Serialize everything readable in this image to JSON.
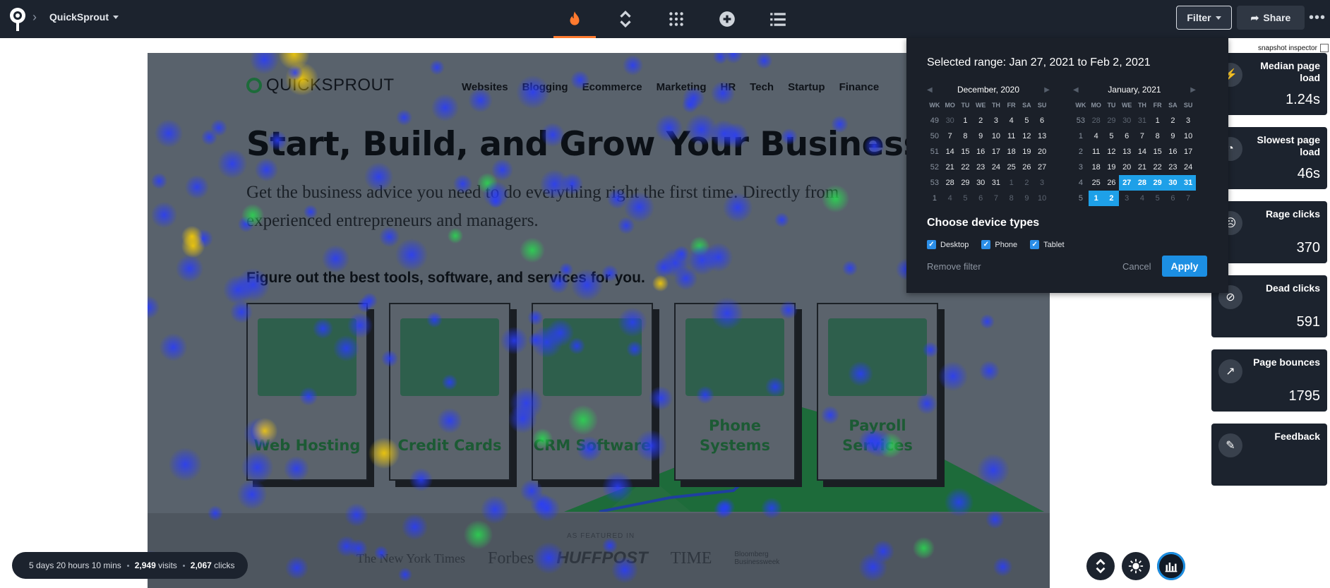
{
  "header": {
    "project_name": "QuickSprout",
    "filter_label": "Filter",
    "share_label": "Share",
    "more_label": "•••",
    "tools": [
      "heatmap",
      "scroll",
      "grid",
      "add",
      "list"
    ]
  },
  "snapshot_inspector": "snapshot inspector",
  "site": {
    "logo_text": "QUICKSPROUT",
    "nav": [
      "Websites",
      "Blogging",
      "Ecommerce",
      "Marketing",
      "HR",
      "Tech",
      "Startup",
      "Finance"
    ],
    "hero_title": "Start, Build, and Grow Your Business",
    "hero_sub": "Get the business advice you need to do everything right the first time. Directly from experienced entrepreneurs and managers.",
    "section_title": "Figure out the best tools, software, and services for you.",
    "cards": [
      {
        "label": "Web Hosting"
      },
      {
        "label": "Credit Cards"
      },
      {
        "label": "CRM Software"
      },
      {
        "label": "Phone Systems"
      },
      {
        "label": "Payroll Services"
      }
    ],
    "featured_caption": "AS FEATURED IN",
    "press": [
      "The New York Times",
      "Forbes",
      "HUFFPOST",
      "TIME",
      "Bloomberg Businessweek"
    ]
  },
  "filter_panel": {
    "range_text": "Selected range: Jan 27, 2021 to Feb 2, 2021",
    "device_heading": "Choose device types",
    "devices": [
      "Desktop",
      "Phone",
      "Tablet"
    ],
    "remove_label": "Remove filter",
    "cancel_label": "Cancel",
    "apply_label": "Apply",
    "calendars": [
      {
        "title": "December, 2020",
        "dow": [
          "WK",
          "MO",
          "TU",
          "WE",
          "TH",
          "FR",
          "SA",
          "SU"
        ],
        "rows": [
          [
            "49",
            "30",
            "1",
            "2",
            "3",
            "4",
            "5",
            "6"
          ],
          [
            "50",
            "7",
            "8",
            "9",
            "10",
            "11",
            "12",
            "13"
          ],
          [
            "51",
            "14",
            "15",
            "16",
            "17",
            "18",
            "19",
            "20"
          ],
          [
            "52",
            "21",
            "22",
            "23",
            "24",
            "25",
            "26",
            "27"
          ],
          [
            "53",
            "28",
            "29",
            "30",
            "31",
            "1",
            "2",
            "3"
          ],
          [
            "1",
            "4",
            "5",
            "6",
            "7",
            "8",
            "9",
            "10"
          ]
        ],
        "out": [
          [
            0,
            1
          ],
          [
            4,
            5
          ],
          [
            4,
            6
          ],
          [
            4,
            7
          ],
          [
            5,
            1
          ],
          [
            5,
            2
          ],
          [
            5,
            3
          ],
          [
            5,
            4
          ],
          [
            5,
            5
          ],
          [
            5,
            6
          ],
          [
            5,
            7
          ]
        ],
        "sel": []
      },
      {
        "title": "January, 2021",
        "dow": [
          "WK",
          "MO",
          "TU",
          "WE",
          "TH",
          "FR",
          "SA",
          "SU"
        ],
        "rows": [
          [
            "53",
            "28",
            "29",
            "30",
            "31",
            "1",
            "2",
            "3"
          ],
          [
            "1",
            "4",
            "5",
            "6",
            "7",
            "8",
            "9",
            "10"
          ],
          [
            "2",
            "11",
            "12",
            "13",
            "14",
            "15",
            "16",
            "17"
          ],
          [
            "3",
            "18",
            "19",
            "20",
            "21",
            "22",
            "23",
            "24"
          ],
          [
            "4",
            "25",
            "26",
            "27",
            "28",
            "29",
            "30",
            "31"
          ],
          [
            "5",
            "1",
            "2",
            "3",
            "4",
            "5",
            "6",
            "7"
          ]
        ],
        "out": [
          [
            0,
            1
          ],
          [
            0,
            2
          ],
          [
            0,
            3
          ],
          [
            0,
            4
          ],
          [
            5,
            3
          ],
          [
            5,
            4
          ],
          [
            5,
            5
          ],
          [
            5,
            6
          ],
          [
            5,
            7
          ]
        ],
        "sel": [
          [
            4,
            3
          ],
          [
            4,
            4
          ],
          [
            4,
            5
          ],
          [
            4,
            6
          ],
          [
            4,
            7
          ],
          [
            5,
            1
          ],
          [
            5,
            2
          ]
        ]
      }
    ]
  },
  "metrics": [
    {
      "title": "Median page load",
      "value": "1.24s",
      "icon": "speed-icon"
    },
    {
      "title": "Slowest page load",
      "value": "46s",
      "icon": "gauge-icon"
    },
    {
      "title": "Rage clicks",
      "value": "370",
      "icon": "angry-face-icon"
    },
    {
      "title": "Dead clicks",
      "value": "591",
      "icon": "no-entry-icon"
    },
    {
      "title": "Page bounces",
      "value": "1795",
      "icon": "bounce-arrow-icon"
    },
    {
      "title": "Feedback",
      "value": "",
      "icon": "feedback-icon"
    }
  ],
  "stats": {
    "duration": "5 days 20 hours 10 mins",
    "visits_value": "2,949",
    "visits_label": "visits",
    "clicks_value": "2,067",
    "clicks_label": "clicks"
  },
  "colors": {
    "accent": "#ff7a2f",
    "selected": "#1ea0e8",
    "apply": "#1c8fe3"
  }
}
